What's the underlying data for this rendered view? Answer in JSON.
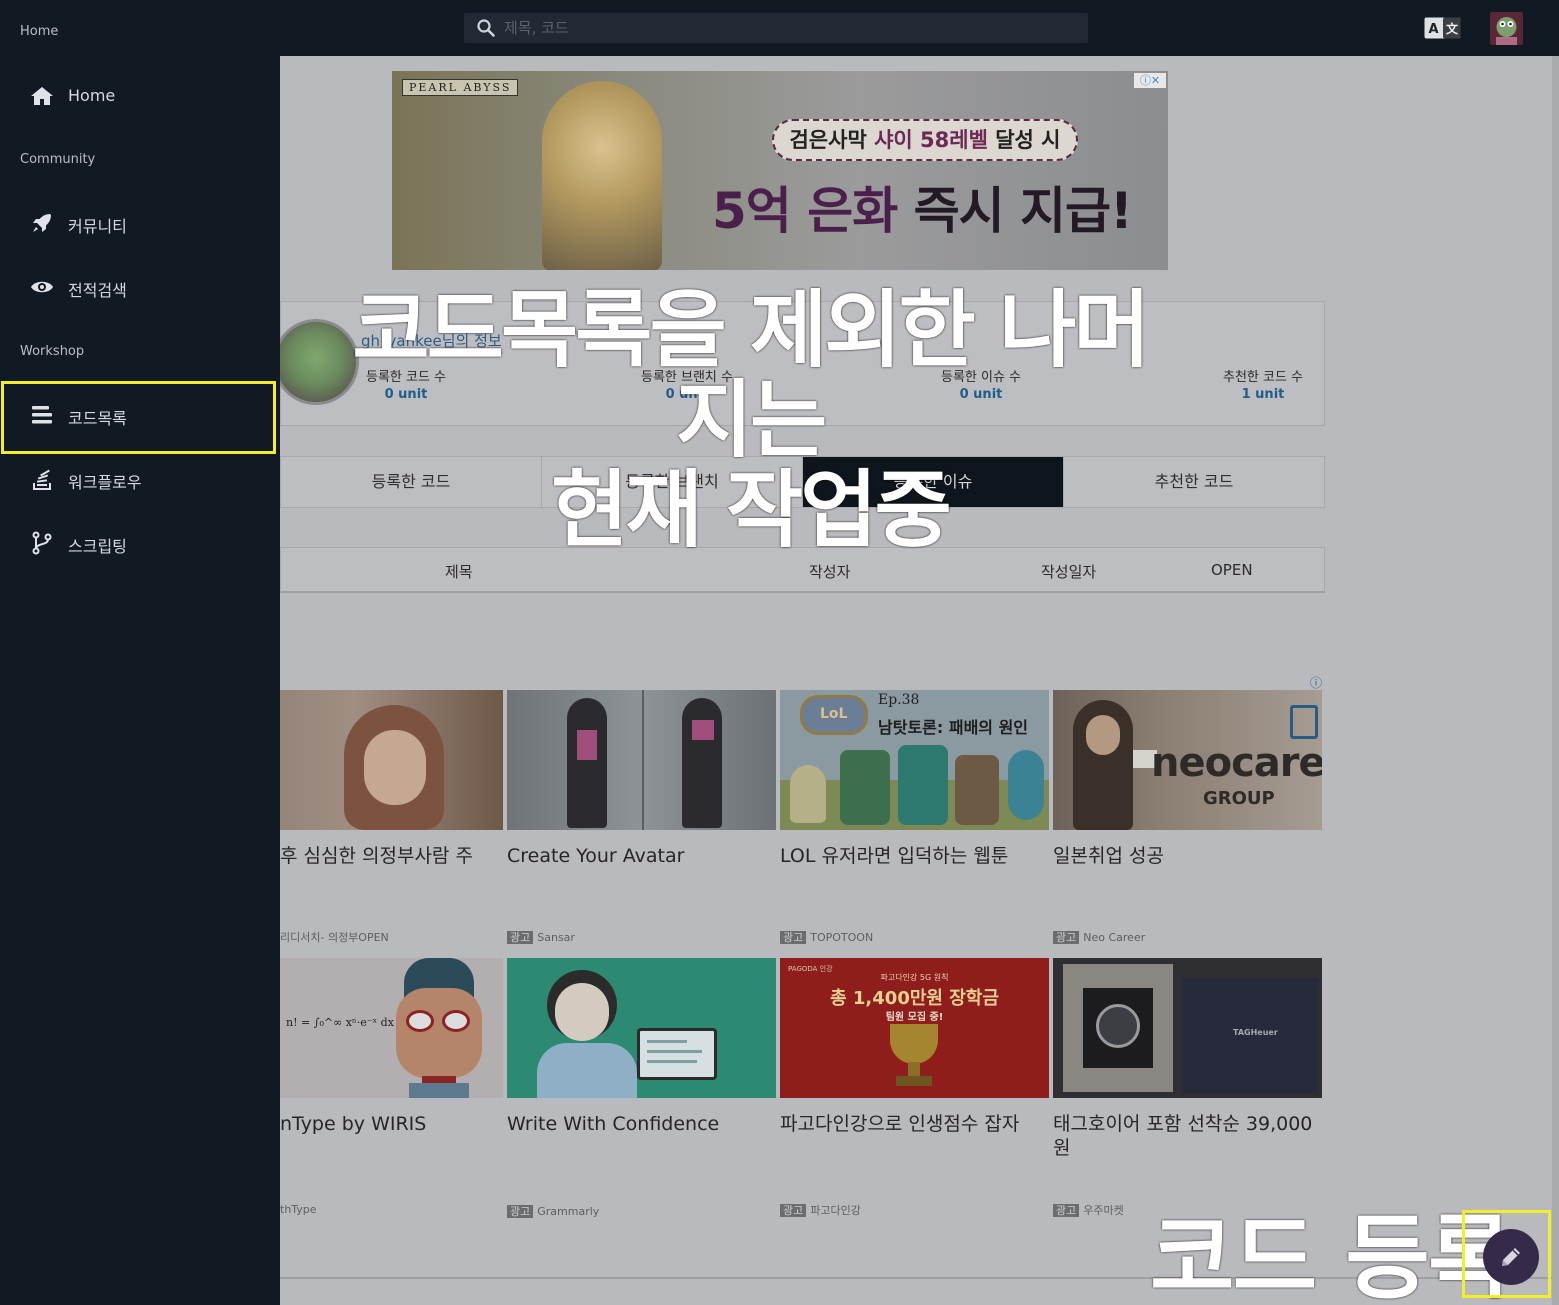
{
  "search": {
    "placeholder": "제목, 코드"
  },
  "icons": {
    "search": "search-icon",
    "translate": "translate-icon",
    "edit": "pencil-icon"
  },
  "sidebar": {
    "sections": [
      {
        "label": "Home"
      },
      {
        "label": "Community"
      },
      {
        "label": "Workshop"
      }
    ],
    "items": [
      {
        "label": "Home",
        "icon": "home-icon"
      },
      {
        "label": "커뮤니티",
        "icon": "rocket-icon"
      },
      {
        "label": "전적검색",
        "icon": "eye-icon"
      },
      {
        "label": "코드목록",
        "icon": "list-icon"
      },
      {
        "label": "워크플로우",
        "icon": "stack-icon"
      },
      {
        "label": "스크립팅",
        "icon": "branch-icon"
      }
    ]
  },
  "banner": {
    "brand": "PEARL ABYSS",
    "line1_a": "검은사막 ",
    "line1_b": "샤이 58레벨",
    "line1_c": " 달성 시",
    "line2_a": "5억 ",
    "line2_b": "은화",
    "line2_c": " 즉시 지급!",
    "adctl": "ⓘ✕"
  },
  "profile": {
    "name": "gh_yankee님의 정보",
    "stats": [
      {
        "label": "등록한 코드 수",
        "value": "0 unit"
      },
      {
        "label": "등록한 브랜치 수",
        "value": "0 unit"
      },
      {
        "label": "등록한 이슈 수",
        "value": "0 unit"
      },
      {
        "label": "추천한 코드 수",
        "value": "1 unit"
      }
    ]
  },
  "tabs": [
    {
      "label": "등록한 코드"
    },
    {
      "label": "등록한 브랜치"
    },
    {
      "label": "등록한 이슈",
      "active": true
    },
    {
      "label": "추천한 코드"
    }
  ],
  "table": {
    "headers": [
      "제목",
      "작성자",
      "작성일자",
      "OPEN"
    ]
  },
  "ads": {
    "info": "ⓘ",
    "ad_badge": "광고",
    "cards": [
      {
        "title": "후 심심한 의정부사람 주",
        "source": "리디서치- 의정부OPEN",
        "badge": false
      },
      {
        "title": "Create Your Avatar",
        "source": "Sansar",
        "badge": true
      },
      {
        "title": "LOL 유저라면 입덕하는 웹툰",
        "source": "TOPOTOON",
        "badge": true
      },
      {
        "title": "일본취업 성공",
        "source": "Neo Career",
        "badge": true
      },
      {
        "title": "nType by WIRIS",
        "source": "thType",
        "badge": false
      },
      {
        "title": "Write With Confidence",
        "source": "Grammarly",
        "badge": true
      },
      {
        "title": "파고다인강으로 인생점수 잡자",
        "source": "파고다인강",
        "badge": true
      },
      {
        "title": "태그호이어 포함 선착순 39,000원",
        "source": "우주마켓",
        "badge": true
      }
    ],
    "image_texts": {
      "lol_ep": "Ep.38",
      "lol_title": "남탓토론: 패배의 원인",
      "neo": "neocareer",
      "neo_group": "GROUP",
      "pagoda_brand": "PAGODA 인강",
      "pagoda_small": "파고다인강 5G 원칙",
      "pagoda_big": "총 1,400만원 장학금",
      "pagoda_sub": "팀원 모집 중!",
      "math": "n! = ∫₀^∞ xⁿ·e⁻ˣ dx",
      "tag": "TAGHeuer"
    }
  },
  "overlay": {
    "line1": "코드목록을 제외한 나머지는",
    "line2": "현재 작업중",
    "register": "코드 등록"
  },
  "colors": {
    "sidebar_bg": "#111a23",
    "highlight": "#f2ee2a",
    "fab": "#362a4b",
    "link": "#1f5e8c"
  }
}
